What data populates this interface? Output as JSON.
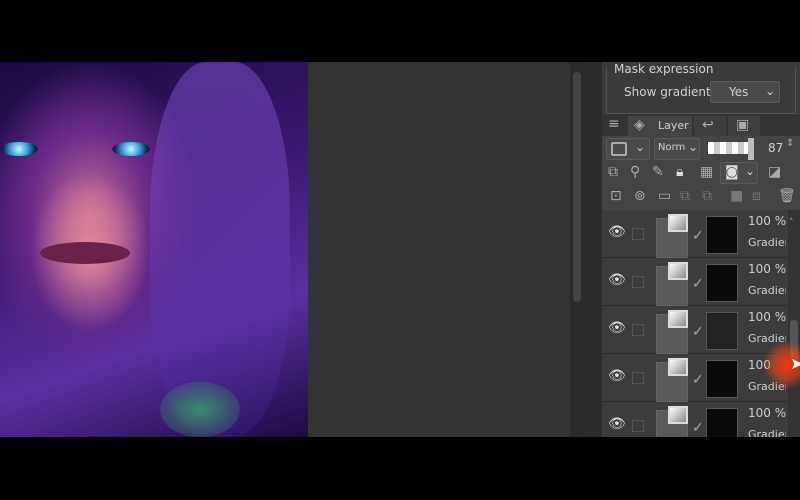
{
  "mask_expression": {
    "title": "Mask expression",
    "show_gradients_label": "Show gradients",
    "show_gradients_value": "Yes"
  },
  "layer_panel": {
    "tab_label": "Layer",
    "blend_mode": "Normal",
    "opacity_value": "87",
    "layers": [
      {
        "opacity": "100 %",
        "name": "Gradient"
      },
      {
        "opacity": "100 %",
        "name": "Gradient"
      },
      {
        "opacity": "100 %",
        "name": "Gradient"
      },
      {
        "opacity": "100",
        "name": "Gradient"
      },
      {
        "opacity": "100 %",
        "name": "Gradient"
      }
    ]
  },
  "colors": {
    "panel": "#3a3a3a",
    "canvas": "#333333",
    "cursor_glow": "#ff3010"
  }
}
